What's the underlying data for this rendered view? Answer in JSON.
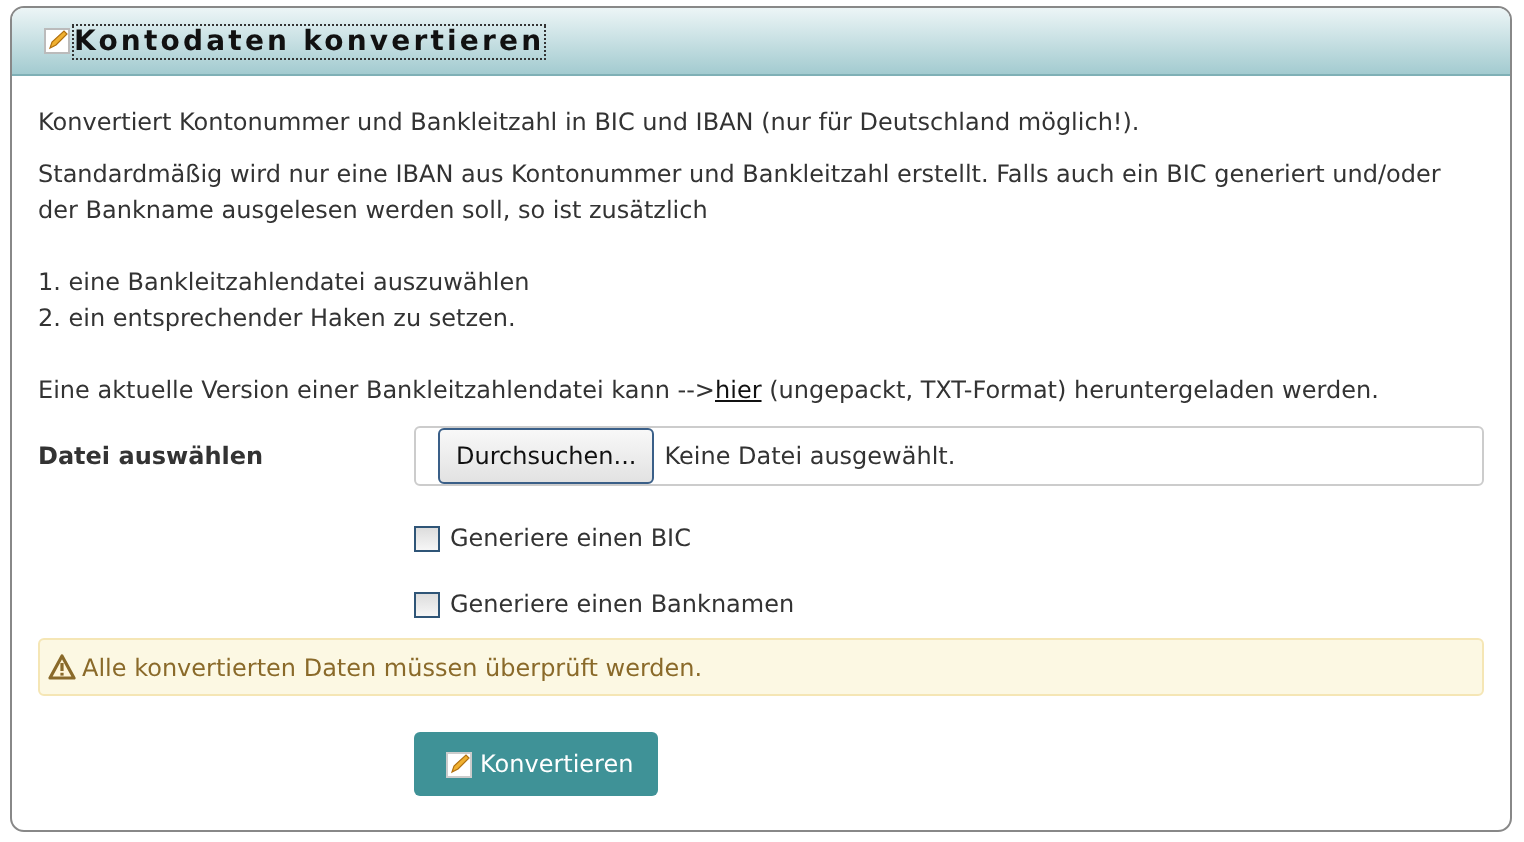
{
  "panel": {
    "title": "Kontodaten konvertieren"
  },
  "intro": "Konvertiert Kontonummer und Bankleitzahl in BIC und IBAN (nur für Deutschland möglich!).",
  "description": "Standardmäßig wird nur eine IBAN aus Kontonummer und Bankleitzahl erstellt. Falls auch ein BIC generiert und/oder der Bankname ausgelesen werden soll, so ist zusätzlich",
  "steps": [
    "1. eine Bankleitzahlendatei auszuwählen",
    "2. ein entsprechender Haken zu setzen."
  ],
  "download": {
    "before": "Eine aktuelle Version einer Bankleitzahlendatei kann -->",
    "link": "hier",
    "after": " (ungepackt, TXT-Format) heruntergeladen werden."
  },
  "file": {
    "label": "Datei auswählen",
    "button": "Durchsuchen...",
    "status": "Keine Datei ausgewählt."
  },
  "options": [
    {
      "label": "Generiere einen BIC",
      "checked": false
    },
    {
      "label": "Generiere einen Banknamen",
      "checked": false
    }
  ],
  "warning": "Alle konvertierten Daten müssen überprüft werden.",
  "submit": "Konvertieren"
}
